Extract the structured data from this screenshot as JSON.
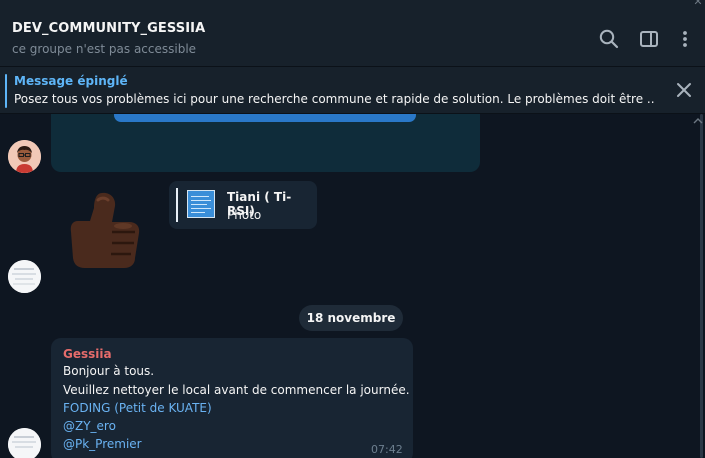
{
  "header": {
    "title": "DEV_COMMUNITY_GESSIIA",
    "status": "ce groupe n'est pas accessible"
  },
  "pinned": {
    "label": "Message épinglé",
    "text": "Posez tous vos problèmes ici pour une recherche commune et rapide de solution. Le problèmes doit être ..."
  },
  "messages": {
    "reply": {
      "name": "Tiani ( Ti-RSI)",
      "subtitle": "Photo"
    },
    "date_separator": "18 novembre",
    "last": {
      "sender": "Gessiia",
      "line1": "Bonjour à tous.",
      "line2": "Veuillez nettoyer le local avant de commencer la journée.",
      "mention1": "FODING (Petit de KUATE)",
      "mention2": "@ZY_ero",
      "mention3": "@Pk_Premier",
      "time": "07:42"
    }
  },
  "icons": {
    "search": "search-icon",
    "panel": "sidebar-toggle-icon",
    "more": "more-vertical-icon",
    "close": "close-icon"
  },
  "colors": {
    "background": "#0e1621",
    "header": "#17212b",
    "accent": "#5eb5f7",
    "bubble": "#182533",
    "sender": "#e66c6b",
    "link": "#6ab3f3"
  }
}
